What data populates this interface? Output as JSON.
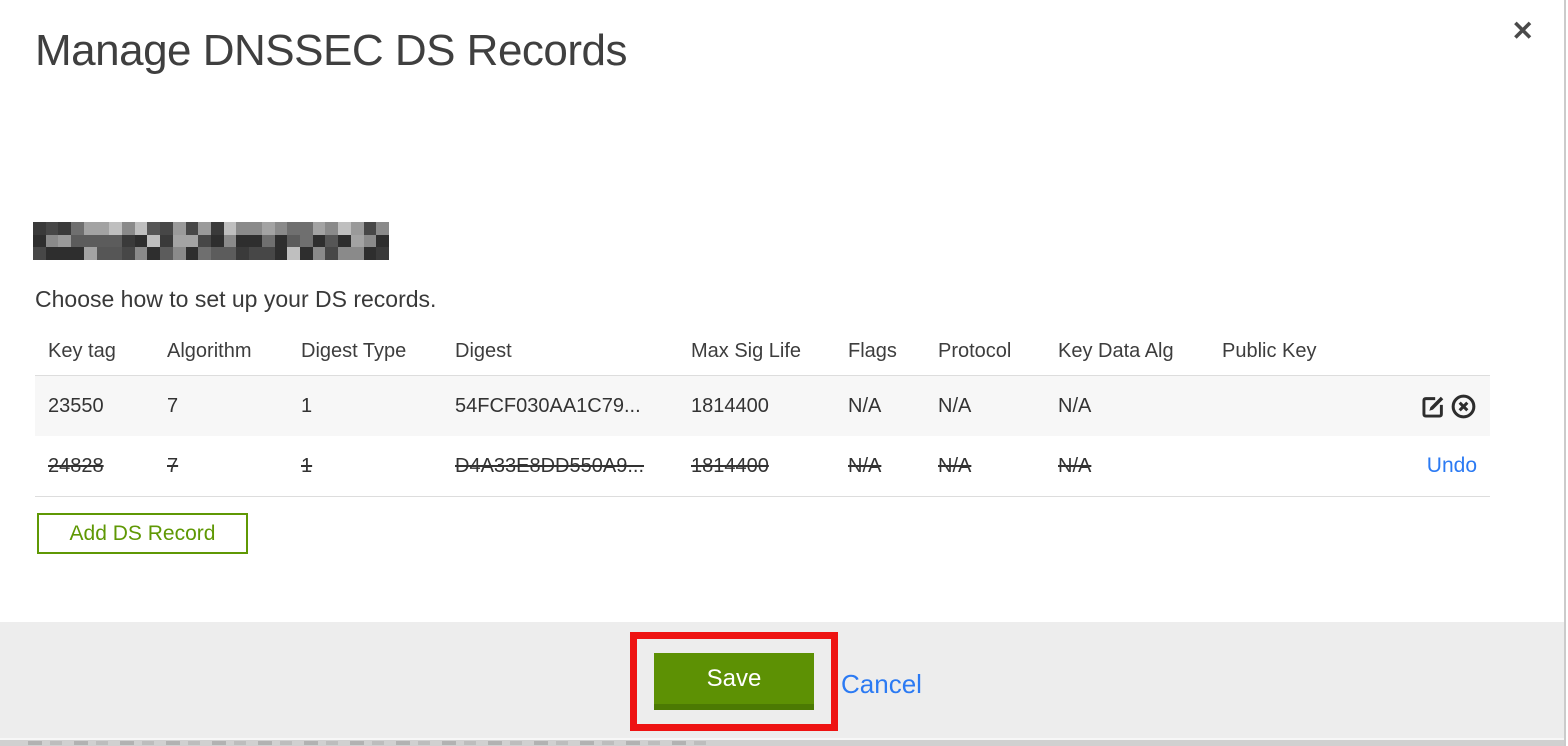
{
  "modal": {
    "title": "Manage DNSSEC DS Records",
    "close_icon": "✕",
    "subtitle": "Choose how to set up your DS records.",
    "table": {
      "columns": [
        "Key tag",
        "Algorithm",
        "Digest Type",
        "Digest",
        "Max Sig Life",
        "Flags",
        "Protocol",
        "Key Data Alg",
        "Public Key"
      ],
      "rows": [
        {
          "key_tag": "23550",
          "algorithm": "7",
          "digest_type": "1",
          "digest": "54FCF030AA1C79...",
          "max_sig_life": "1814400",
          "flags": "N/A",
          "protocol": "N/A",
          "key_data_alg": "N/A",
          "public_key": "",
          "state": "existing"
        },
        {
          "key_tag": "24828",
          "algorithm": "7",
          "digest_type": "1",
          "digest": "D4A33E8DD550A9...",
          "max_sig_life": "1814400",
          "flags": "N/A",
          "protocol": "N/A",
          "key_data_alg": "N/A",
          "public_key": "",
          "state": "marked-for-deletion",
          "undo_label": "Undo"
        }
      ]
    },
    "add_button_label": "Add DS Record",
    "footer": {
      "save_label": "Save",
      "cancel_label": "Cancel"
    },
    "colors": {
      "accent_green": "#5d9104",
      "add_button_green": "#5f9804",
      "link_blue": "#2b7af3",
      "annotation_red": "#ee1312",
      "footer_gray": "#ededed",
      "row_stripe": "#f7f7f7"
    }
  }
}
